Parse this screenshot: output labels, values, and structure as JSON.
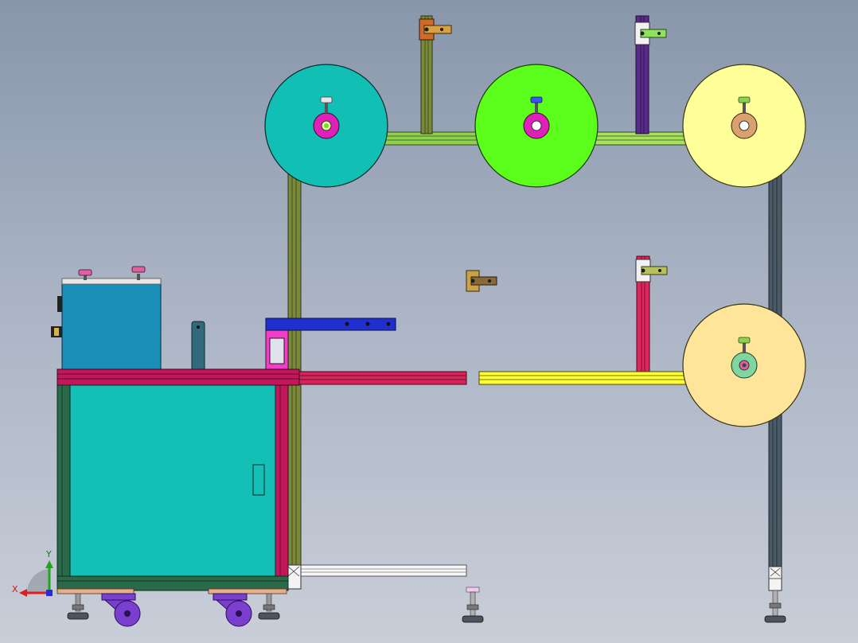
{
  "view": {
    "background_top": "#8896ab",
    "background_bottom": "#c9ced8"
  },
  "axis_triad": {
    "x_label": "X",
    "y_label": "Y",
    "x_color": "#e31d1d",
    "y_color": "#1fa51f"
  },
  "colors": {
    "roll_teal": "#12bfb5",
    "roll_green": "#5cff1c",
    "roll_yellow": "#ffff99",
    "roll_peach": "#ffe599",
    "profile_olive": "#7a8a3a",
    "profile_purple": "#5a2a8a",
    "profile_slate": "#4a5a66",
    "profile_crimson": "#e0245e",
    "cabinet_frame": "#c2185b",
    "cabinet_body": "#14bfb5",
    "control_box": "#1a8fb8",
    "guide_blue": "#2030d0",
    "rail_yellow": "#ffff33",
    "caster_purple": "#7b3fcf"
  }
}
